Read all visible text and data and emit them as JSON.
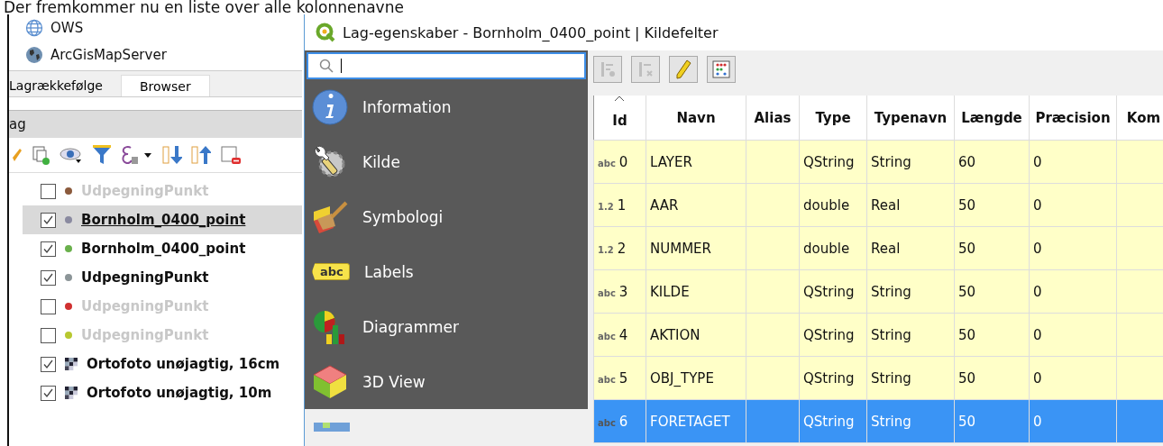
{
  "caption": "Der fremkommer nu en liste over alle kolonnenavne",
  "browser_items": [
    {
      "label": "OWS",
      "kind": "globe"
    },
    {
      "label": "ArcGisMapServer",
      "kind": "earth"
    }
  ],
  "tabs": [
    {
      "label": "Lagrækkefølge",
      "selected": false
    },
    {
      "label": "Browser",
      "selected": true
    }
  ],
  "layers_header": "ag",
  "layers": [
    {
      "label": "UdpegningPunkt",
      "checked": false,
      "color": "#8b5a3c",
      "kind": "point",
      "selected": false
    },
    {
      "label": "Bornholm_0400_point",
      "checked": true,
      "color": "#8a8aa0",
      "kind": "point",
      "selected": true
    },
    {
      "label": "Bornholm_0400_point",
      "checked": true,
      "color": "#6ab04c",
      "kind": "point",
      "selected": false
    },
    {
      "label": "UdpegningPunkt",
      "checked": true,
      "color": "#8c9598",
      "kind": "point",
      "selected": false
    },
    {
      "label": "UdpegningPunkt",
      "checked": false,
      "color": "#d03030",
      "kind": "point",
      "selected": false
    },
    {
      "label": "UdpegningPunkt",
      "checked": false,
      "color": "#b8c830",
      "kind": "point",
      "selected": false
    },
    {
      "label": "Ortofoto unøjagtig, 16cm",
      "checked": true,
      "kind": "raster",
      "selected": false
    },
    {
      "label": "Ortofoto unøjagtig, 10m",
      "checked": true,
      "kind": "raster",
      "selected": false
    }
  ],
  "dialog": {
    "title": "Lag-egenskaber - Bornholm_0400_point | Kildefelter",
    "sections": [
      {
        "label": "Information",
        "kind": "info"
      },
      {
        "label": "Kilde",
        "kind": "source"
      },
      {
        "label": "Symbologi",
        "kind": "brush"
      },
      {
        "label": "Labels",
        "kind": "labels",
        "badge": "abc"
      },
      {
        "label": "Diagrammer",
        "kind": "diagram"
      },
      {
        "label": "3D View",
        "kind": "cube"
      }
    ],
    "toolbar": [
      {
        "kind": "add",
        "disabled": true
      },
      {
        "kind": "delete",
        "disabled": true
      },
      {
        "kind": "edit",
        "disabled": false
      },
      {
        "kind": "calculator",
        "disabled": false
      }
    ],
    "table": {
      "columns": [
        "Id",
        "Navn",
        "Alias",
        "Type",
        "Typenavn",
        "Længde",
        "Præcision",
        "Kom"
      ],
      "rows": [
        {
          "type_icon": "abc",
          "id": "0",
          "name": "LAYER",
          "type": "QString",
          "typename": "String",
          "length": "60",
          "precision": "0",
          "selected": false
        },
        {
          "type_icon": "1.2",
          "id": "1",
          "name": "AAR",
          "type": "double",
          "typename": "Real",
          "length": "50",
          "precision": "0",
          "selected": false
        },
        {
          "type_icon": "1.2",
          "id": "2",
          "name": "NUMMER",
          "type": "double",
          "typename": "Real",
          "length": "50",
          "precision": "0",
          "selected": false
        },
        {
          "type_icon": "abc",
          "id": "3",
          "name": "KILDE",
          "type": "QString",
          "typename": "String",
          "length": "50",
          "precision": "0",
          "selected": false
        },
        {
          "type_icon": "abc",
          "id": "4",
          "name": "AKTION",
          "type": "QString",
          "typename": "String",
          "length": "50",
          "precision": "0",
          "selected": false
        },
        {
          "type_icon": "abc",
          "id": "5",
          "name": "OBJ_TYPE",
          "type": "QString",
          "typename": "String",
          "length": "50",
          "precision": "0",
          "selected": false
        },
        {
          "type_icon": "abc",
          "id": "6",
          "name": "FORETAGET",
          "type": "QString",
          "typename": "String",
          "length": "50",
          "precision": "0",
          "selected": true
        }
      ]
    }
  }
}
